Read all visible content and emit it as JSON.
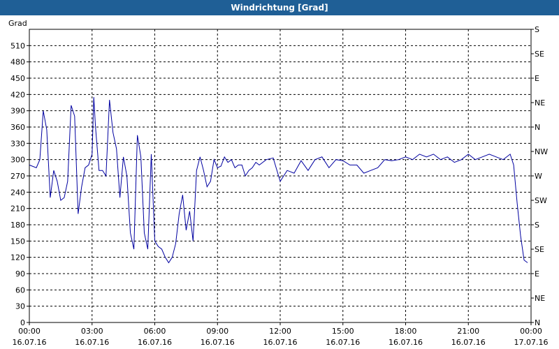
{
  "window": {
    "title": "Windrichtung [Grad]"
  },
  "chart_data": {
    "type": "line",
    "title": "Windrichtung [Grad]",
    "ylabel": "Grad",
    "xlabel": "",
    "ylim": [
      0,
      540
    ],
    "yticks": [
      0,
      30,
      60,
      90,
      120,
      150,
      180,
      210,
      240,
      270,
      300,
      330,
      360,
      390,
      420,
      450,
      480,
      510
    ],
    "right_axis_labels": [
      "N",
      "NE",
      "E",
      "SE",
      "S",
      "SW",
      "W",
      "NW",
      "N",
      "NE",
      "E",
      "SE",
      "S"
    ],
    "xlim": [
      "16.07.16 00:00",
      "17.07.16 00:00"
    ],
    "xticks": [
      {
        "time": "00:00",
        "date": "16.07.16"
      },
      {
        "time": "03:00",
        "date": "16.07.16"
      },
      {
        "time": "06:00",
        "date": "16.07.16"
      },
      {
        "time": "09:00",
        "date": "16.07.16"
      },
      {
        "time": "12:00",
        "date": "16.07.16"
      },
      {
        "time": "15:00",
        "date": "16.07.16"
      },
      {
        "time": "18:00",
        "date": "16.07.16"
      },
      {
        "time": "21:00",
        "date": "16.07.16"
      },
      {
        "time": "00:00",
        "date": "17.07.16"
      }
    ],
    "grid": true,
    "line_color": "#0000a0",
    "series": [
      {
        "name": "",
        "x": [
          "00:00",
          "00:20",
          "00:30",
          "00:40",
          "00:50",
          "01:00",
          "01:10",
          "01:20",
          "01:30",
          "01:40",
          "01:50",
          "02:00",
          "02:10",
          "02:20",
          "02:30",
          "02:40",
          "02:50",
          "03:00",
          "03:05",
          "03:10",
          "03:20",
          "03:30",
          "03:40",
          "03:50",
          "04:00",
          "04:10",
          "04:20",
          "04:30",
          "04:40",
          "04:50",
          "05:00",
          "05:10",
          "05:20",
          "05:30",
          "05:40",
          "05:50",
          "06:00",
          "06:10",
          "06:20",
          "06:30",
          "06:40",
          "06:50",
          "07:00",
          "07:10",
          "07:20",
          "07:30",
          "07:40",
          "07:50",
          "08:00",
          "08:10",
          "08:20",
          "08:30",
          "08:40",
          "08:50",
          "09:00",
          "09:10",
          "09:20",
          "09:30",
          "09:40",
          "09:50",
          "10:00",
          "10:10",
          "10:20",
          "10:30",
          "10:40",
          "10:50",
          "11:00",
          "11:20",
          "11:40",
          "12:00",
          "12:20",
          "12:40",
          "13:00",
          "13:20",
          "13:40",
          "14:00",
          "14:20",
          "14:40",
          "15:00",
          "15:20",
          "15:40",
          "16:00",
          "16:20",
          "16:40",
          "17:00",
          "17:20",
          "17:40",
          "18:00",
          "18:20",
          "18:40",
          "19:00",
          "19:20",
          "19:40",
          "20:00",
          "20:20",
          "20:40",
          "21:00",
          "21:20",
          "21:40",
          "22:00",
          "22:20",
          "22:40",
          "23:00",
          "23:10",
          "23:20",
          "23:30",
          "23:40",
          "23:50"
        ],
        "y": [
          290,
          285,
          300,
          390,
          355,
          230,
          280,
          260,
          225,
          230,
          260,
          400,
          380,
          200,
          250,
          285,
          290,
          310,
          415,
          360,
          280,
          280,
          270,
          410,
          350,
          320,
          230,
          305,
          270,
          165,
          135,
          345,
          305,
          165,
          135,
          310,
          150,
          140,
          135,
          120,
          110,
          120,
          145,
          200,
          235,
          170,
          205,
          150,
          280,
          305,
          280,
          250,
          260,
          300,
          285,
          288,
          305,
          295,
          300,
          285,
          290,
          290,
          270,
          280,
          285,
          295,
          290,
          300,
          303,
          260,
          280,
          275,
          298,
          280,
          300,
          305,
          285,
          300,
          298,
          290,
          290,
          275,
          280,
          285,
          300,
          298,
          300,
          305,
          300,
          310,
          305,
          310,
          300,
          305,
          295,
          300,
          310,
          300,
          305,
          310,
          305,
          300,
          310,
          290,
          220,
          160,
          115,
          110
        ]
      }
    ]
  }
}
